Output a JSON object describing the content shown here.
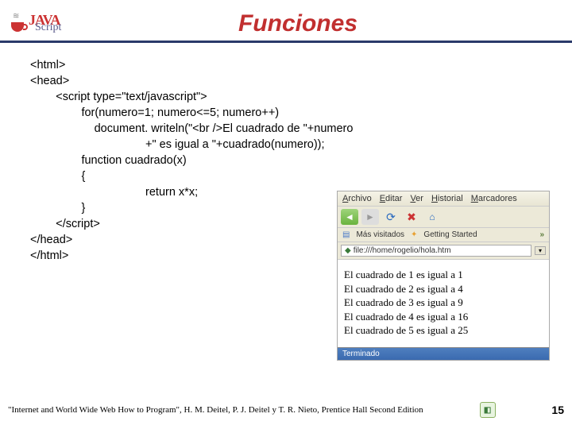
{
  "header": {
    "logo": {
      "java": "JAVA",
      "script": "Script"
    },
    "title": "Funciones"
  },
  "code": {
    "lines": [
      "<html>",
      "<head>",
      "        <script type=\"text/javascript\">",
      "                for(numero=1; numero<=5; numero++)",
      "                    document. writeln(\"<br />El cuadrado de \"+numero",
      "                                    +\" es igual a \"+cuadrado(numero));",
      "                function cuadrado(x)",
      "                {",
      "                                    return x*x;",
      "                }",
      "        </script>",
      "</head>",
      "</html>"
    ]
  },
  "browser": {
    "menu": [
      "Archivo",
      "Editar",
      "Ver",
      "Historial",
      "Marcadores"
    ],
    "bookmarks": {
      "most_visited": "Más visitados",
      "getting_started": "Getting Started",
      "chevron": "»"
    },
    "url": "file:///home/rogelio/hola.htm",
    "output": [
      "El cuadrado de 1 es igual a 1",
      "El cuadrado de 2 es igual a 4",
      "El cuadrado de 3 es igual a 9",
      "El cuadrado de 4 es igual a 16",
      "El cuadrado de 5 es igual a 25"
    ],
    "status": "Terminado"
  },
  "footer": {
    "citation": "\"Internet and World Wide Web How to Program\", H. M. Deitel, P. J. Deitel y T. R. Nieto, Prentice Hall Second Edition",
    "page": "15"
  }
}
